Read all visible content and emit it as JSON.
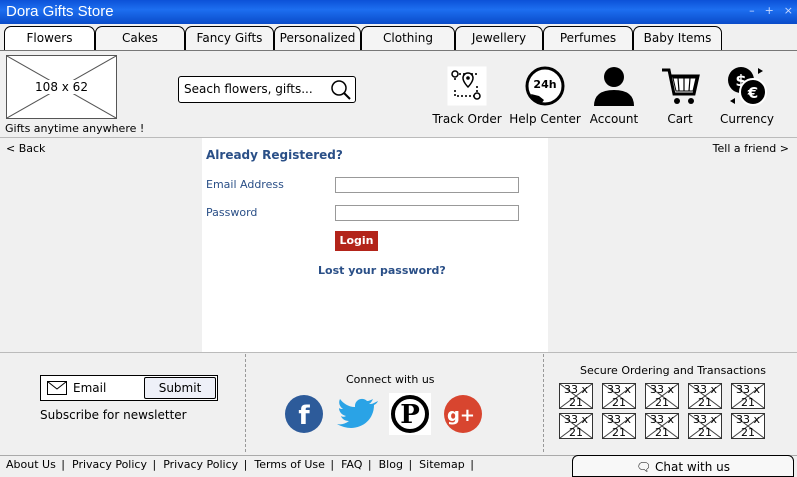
{
  "window": {
    "title": "Dora Gifts Store",
    "controls": [
      "–",
      "+",
      "×"
    ]
  },
  "tabs": [
    "Flowers",
    "Cakes",
    "Fancy Gifts",
    "Personalized",
    "Clothing",
    "Jewellery",
    "Perfumes",
    "Baby Items"
  ],
  "logo": {
    "placeholder": "108 x 62",
    "tagline": "Gifts anytime anywhere !"
  },
  "search": {
    "placeholder": "Seach flowers, gifts..."
  },
  "header_icons": [
    {
      "label": "Track Order",
      "icon": "track-order-icon"
    },
    {
      "label": "Help Center",
      "icon": "24h-support-icon"
    },
    {
      "label": "Account",
      "icon": "user-icon"
    },
    {
      "label": "Cart",
      "icon": "shopping-cart-icon"
    },
    {
      "label": "Currency",
      "icon": "currency-exchange-icon"
    }
  ],
  "nav": {
    "back": "< Back",
    "tell": "Tell a friend >"
  },
  "login": {
    "heading": "Already Registered?",
    "email_label": "Email Address",
    "password_label": "Password",
    "button": "Login",
    "lost": "Lost your password?"
  },
  "newsletter": {
    "email_placeholder": "Email",
    "submit": "Submit",
    "label": "Subscribe for newsletter"
  },
  "social": {
    "title": "Connect with us",
    "networks": [
      "facebook-icon",
      "twitter-icon",
      "pinterest-icon",
      "google-plus-icon"
    ]
  },
  "secure": {
    "title": "Secure Ordering and Transactions",
    "badge_top": "33 x",
    "badge_bottom": "21"
  },
  "footer": {
    "links": [
      "About Us",
      "Privacy Policy",
      "Privacy Policy",
      "Terms of Use",
      "FAQ",
      "Blog",
      "Sitemap"
    ],
    "chat": "Chat with us"
  },
  "colors": {
    "titlebar": "#0c52d8",
    "link_blue": "#2a4f87",
    "login_button": "#b3241a"
  }
}
